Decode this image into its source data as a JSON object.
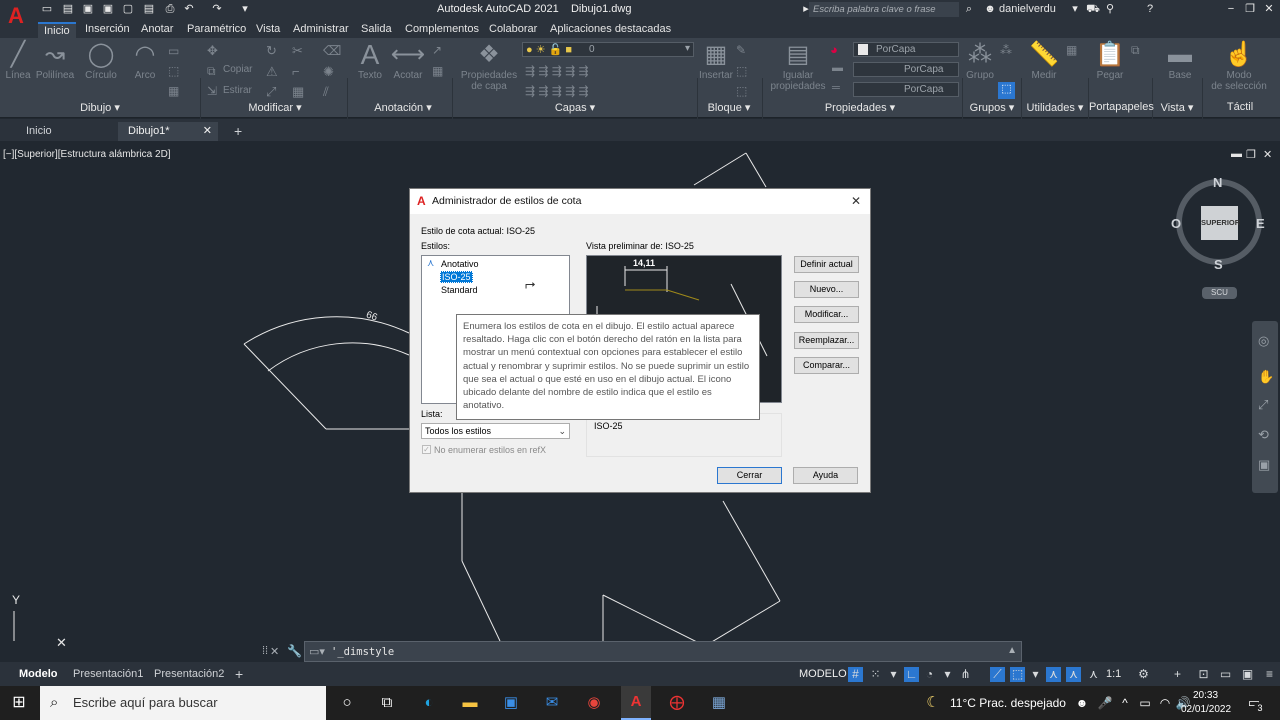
{
  "window": {
    "title": "Autodesk AutoCAD 2021",
    "doc": "Dibujo1.dwg",
    "search_placeholder": "Escriba palabra clave o frase",
    "user": "danielverdu"
  },
  "ribbon": {
    "tabs": [
      "Inicio",
      "Inserción",
      "Anotar",
      "Paramétrico",
      "Vista",
      "Administrar",
      "Salida",
      "Complementos",
      "Colaborar",
      "Aplicaciones destacadas"
    ],
    "tools": {
      "linea": "Línea",
      "polilinea": "Polilínea",
      "circulo": "Círculo",
      "arco": "Arco",
      "copiar": "Copiar",
      "estirar": "Estirar",
      "texto": "Texto",
      "acotar": "Acotar",
      "propiedades_capa_1": "Propiedades",
      "propiedades_capa_2": "de capa",
      "layer_value": "0",
      "insertar": "Insertar",
      "igualar_1": "Igualar",
      "igualar_2": "propiedades",
      "porcapa_1": "PorCapa",
      "porcapa_2": "PorCapa",
      "porcapa_3": "PorCapa",
      "grupo": "Grupo",
      "medir": "Medir",
      "pegar": "Pegar",
      "base": "Base",
      "modo_1": "Modo",
      "modo_2": "de selección"
    },
    "panels": [
      "Dibujo",
      "Modificar",
      "Anotación",
      "Capas",
      "Bloque",
      "Propiedades",
      "Grupos",
      "Utilidades",
      "Portapapeles",
      "Vista",
      "Táctil"
    ]
  },
  "doc_tabs": [
    "Inicio",
    "Dibujo1*"
  ],
  "viewport": {
    "label": "[−][Superior][Estructura alámbrica 2D]",
    "viewcube": {
      "n": "N",
      "s": "S",
      "e": "E",
      "o": "O",
      "face": "SUPERIOR",
      "ucs": "SCU"
    },
    "axis_y": "Y",
    "arc_dim": "66"
  },
  "dialog": {
    "title": "Administrador de estilos de cota",
    "current_style": "Estilo de cota actual: ISO-25",
    "styles_label": "Estilos:",
    "styles": [
      "Anotativo",
      "ISO-25",
      "Standard"
    ],
    "preview_label": "Vista preliminar de: ISO-25",
    "preview_dim": "14,11",
    "list_label": "Lista:",
    "list_value": "Todos los estilos",
    "checkbox_label": "No enumerar estilos en refX",
    "description": "ISO-25",
    "buttons": {
      "set_current": "Definir actual",
      "new": "Nuevo...",
      "modify": "Modificar...",
      "override": "Reemplazar...",
      "compare": "Comparar...",
      "close": "Cerrar",
      "help": "Ayuda"
    },
    "tooltip": "Enumera los estilos de cota en el dibujo. El estilo actual aparece resaltado. Haga clic con el botón derecho del ratón en la lista para mostrar un menú contextual con opciones para establecer el estilo actual y renombrar y suprimir estilos. No se puede suprimir un estilo que sea el actual o que esté en uso en el dibujo actual. El icono ubicado delante del nombre de estilo indica que el estilo es anotativo."
  },
  "command_line": "'_dimstyle",
  "layout_tabs": [
    "Modelo",
    "Presentación1",
    "Presentación2"
  ],
  "status": {
    "mode": "MODELO",
    "scale": "1:1"
  },
  "taskbar": {
    "search": "Escribe aquí para buscar",
    "weather": "11°C  Prac. despejado",
    "time": "20:33",
    "date": "02/01/2022",
    "notif": "3"
  },
  "colors": {
    "accent": "#2b77d0",
    "selection": "#0078d7",
    "bg": "#212830",
    "ribbon": "#3b434d"
  }
}
